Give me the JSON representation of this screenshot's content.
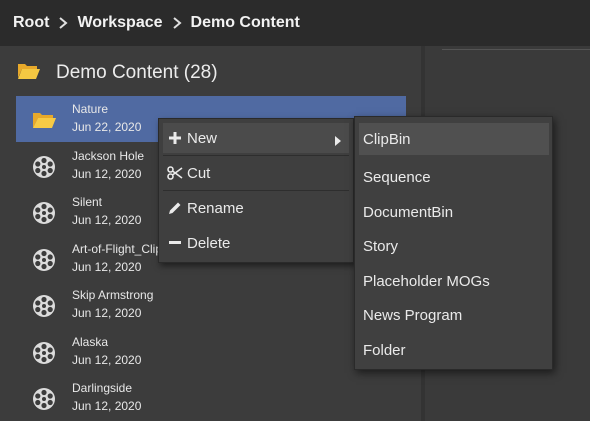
{
  "breadcrumb": {
    "items": [
      "Root",
      "Workspace",
      "Demo Content"
    ]
  },
  "folder": {
    "title": "Demo Content (28)",
    "icon": "open-folder-icon"
  },
  "items": [
    {
      "name": "Nature",
      "date": "Jun 22, 2020",
      "icon": "folder-icon",
      "selected": true
    },
    {
      "name": "Jackson Hole",
      "date": "Jun 12, 2020",
      "icon": "film-reel-icon"
    },
    {
      "name": "Silent",
      "date": "Jun 12, 2020",
      "icon": "film-reel-icon"
    },
    {
      "name": "Art-of-Flight_Clip",
      "date": "Jun 12, 2020",
      "icon": "film-reel-icon"
    },
    {
      "name": "Skip Armstrong",
      "date": "Jun 12, 2020",
      "icon": "film-reel-icon"
    },
    {
      "name": "Alaska",
      "date": "Jun 12, 2020",
      "icon": "film-reel-icon"
    },
    {
      "name": "Darlingside",
      "date": "Jun 12, 2020",
      "icon": "film-reel-icon"
    }
  ],
  "context_menu": {
    "new_label": "New",
    "cut_label": "Cut",
    "rename_label": "Rename",
    "delete_label": "Delete"
  },
  "submenu": {
    "items": [
      "ClipBin",
      "Sequence",
      "DocumentBin",
      "Story",
      "Placeholder MOGs",
      "News Program",
      "Folder"
    ],
    "highlighted": "ClipBin"
  },
  "colors": {
    "selection": "#506aa2",
    "folder_yellow": "#f2c23a",
    "background": "#3a3a3a",
    "header": "#2b2b2b"
  }
}
